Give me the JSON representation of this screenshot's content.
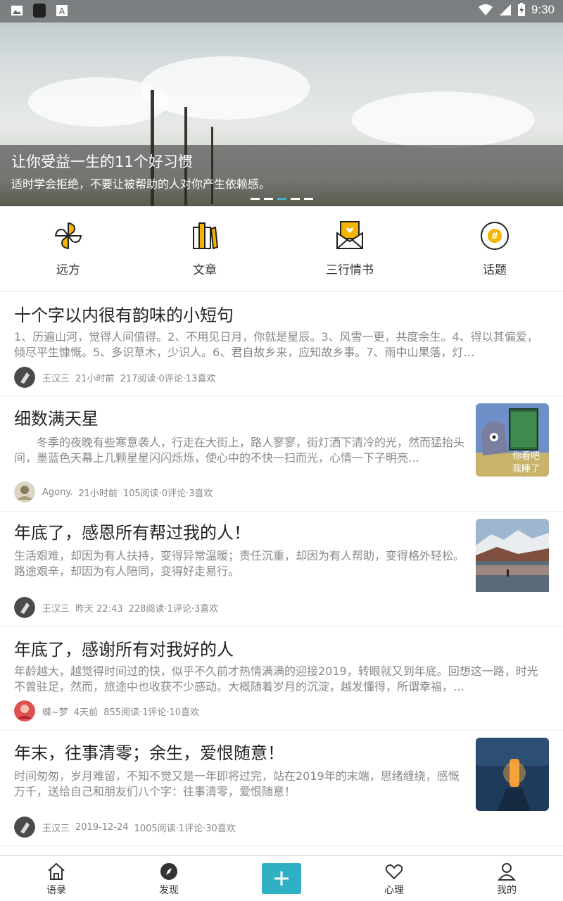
{
  "status_bar": {
    "time": "9:30"
  },
  "banner": {
    "title": "让你受益一生的11个好习惯",
    "subtitle": "适时学会拒绝，不要让被帮助的人对你产生依赖感。",
    "slide_count": 5,
    "active_slide": 3
  },
  "categories": [
    {
      "label": "远方",
      "icon": "pinwheel-icon"
    },
    {
      "label": "文章",
      "icon": "books-icon"
    },
    {
      "label": "三行情书",
      "icon": "love-letter-icon"
    },
    {
      "label": "话题",
      "icon": "topic-hash-icon"
    }
  ],
  "feed": [
    {
      "title": "十个字以内很有韵味的小短句",
      "body": "1、历遍山河，觉得人间值得。2、不用见日月，你就是星辰。3、风雪一更，共度余生。4、得以其偏爱，倾尽平生慷慨。5、多识草木，少识人。6、君自故乡来，应知故乡事。7、雨中山果落，灯…",
      "author": "王汉三",
      "time": "21小时前",
      "stats": "217阅读·0评论·13喜欢"
    },
    {
      "title": "细数满天星",
      "body": "　　冬季的夜晚有些寒意袭人，行走在大街上，路人寥寥，街灯洒下清冷的光，然而猛抬头间，墨蓝色天幕上几颗星星闪闪烁烁，使心中的不快一扫而光，心情一下子明亮…",
      "author": "Agony.",
      "time": "21小时前",
      "stats": "105阅读·0评论·3喜欢",
      "thumb_text": "你看吧 我睡了"
    },
    {
      "title": "年底了，感恩所有帮过我的人！",
      "body": "生活艰难，却因为有人扶持，变得异常温暖；责任沉重，却因为有人帮助，变得格外轻松。路途艰辛，却因为有人陪同，变得好走易行。",
      "author": "王汉三",
      "time": "昨天 22:43",
      "stats": "228阅读·1评论·3喜欢"
    },
    {
      "title": "年底了，感谢所有对我好的人",
      "body": "年龄越大，越觉得时间过的快，似乎不久前才热情满满的迎接2019，转眼就又到年底。回想这一路，时光不曾驻足，然而，旅途中也收获不少感动。大概随着岁月的沉淀，越发懂得，所谓幸福，…",
      "author": "蝶~梦",
      "time": "4天前",
      "stats": "855阅读·1评论·10喜欢"
    },
    {
      "title": "年末，往事清零；余生，爱恨随意！",
      "body": "时间匆匆，岁月难留，不知不觉又是一年即将过完，站在2019年的末端，思绪缠绕，感慨万千，送给自己和朋友们八个字：往事清零，爱恨随意！",
      "author": "王汉三",
      "time": "2019-12-24",
      "stats": "1005阅读·1评论·30喜欢"
    }
  ],
  "tabbar": {
    "tabs": [
      {
        "label": "语录",
        "icon": "home-icon"
      },
      {
        "label": "发现",
        "icon": "compass-icon"
      },
      {
        "label": "心理",
        "icon": "heart-icon"
      },
      {
        "label": "我的",
        "icon": "person-icon"
      }
    ],
    "add_icon": "plus-icon"
  },
  "colors": {
    "accent": "#2fb0c4",
    "icon_yellow": "#f5b400"
  }
}
